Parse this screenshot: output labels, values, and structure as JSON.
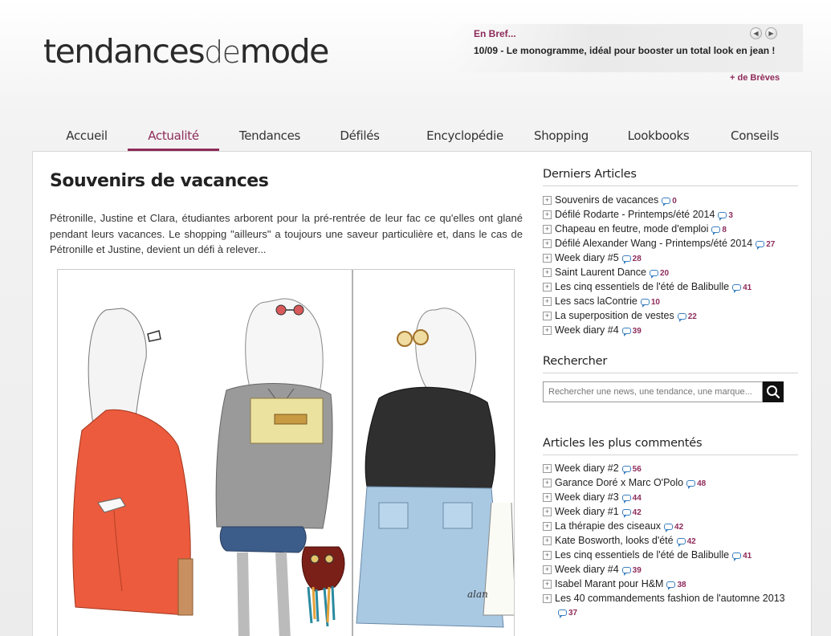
{
  "header": {
    "logo_main": "tendances",
    "logo_de": "de",
    "logo_end": "mode",
    "brief_title": "En Bref...",
    "brief_text": "10/09 - Le monogramme, idéal pour booster un total look en jean !",
    "brief_more": "+ de Brèves",
    "arrow_prev": "◀",
    "arrow_next": "▶"
  },
  "nav": [
    {
      "label": "Accueil"
    },
    {
      "label": "Actualité",
      "active": true
    },
    {
      "label": "Tendances"
    },
    {
      "label": "Défilés"
    },
    {
      "label": "Encyclopédie"
    },
    {
      "label": "Shopping"
    },
    {
      "label": "Lookbooks"
    },
    {
      "label": "Conseils"
    }
  ],
  "article": {
    "title": "Souvenirs de vacances",
    "intro": "Pétronille, Justine et Clara, étudiantes arborent pour la pré-rentrée de leur fac ce qu'elles ont glané pendant leurs vacances. Le shopping \"ailleurs\" a toujours une saveur particulière et, dans le cas de Pétronille et Justine, devient un défi à relever...",
    "illustration_signature": "alan"
  },
  "sidebar": {
    "latest_title": "Derniers Articles",
    "latest": [
      {
        "label": "Souvenirs de vacances",
        "count": "0"
      },
      {
        "label": "Défilé Rodarte - Printemps/été 2014",
        "count": "3"
      },
      {
        "label": "Chapeau en feutre, mode d'emploi",
        "count": "8"
      },
      {
        "label": "Défilé Alexander Wang - Printemps/été 2014",
        "count": "27"
      },
      {
        "label": "Week diary #5",
        "count": "28"
      },
      {
        "label": "Saint Laurent Dance",
        "count": "20"
      },
      {
        "label": "Les cinq essentiels de l'été de Balibulle",
        "count": "41"
      },
      {
        "label": "Les sacs laContrie",
        "count": "10"
      },
      {
        "label": "La superposition de vestes",
        "count": "22"
      },
      {
        "label": "Week diary #4",
        "count": "39"
      }
    ],
    "search_title": "Rechercher",
    "search_placeholder": "Rechercher une news, une tendance, une marque...",
    "commented_title": "Articles les plus commentés",
    "commented": [
      {
        "label": "Week diary #2",
        "count": "56"
      },
      {
        "label": "Garance Doré x Marc O'Polo",
        "count": "48"
      },
      {
        "label": "Week diary #3",
        "count": "44"
      },
      {
        "label": "Week diary #1",
        "count": "42"
      },
      {
        "label": "La thérapie des ciseaux",
        "count": "42"
      },
      {
        "label": "Kate Bosworth, looks d'été",
        "count": "42"
      },
      {
        "label": "Les cinq essentiels de l'été de Balibulle",
        "count": "41"
      },
      {
        "label": "Week diary #4",
        "count": "39"
      },
      {
        "label": "Isabel Marant pour H&M",
        "count": "38"
      },
      {
        "label": "Les 40 commandements fashion de l'automne 2013",
        "count": "37"
      }
    ]
  },
  "colors": {
    "accent": "#8e2b5a",
    "bubble": "#3b7fc0"
  }
}
